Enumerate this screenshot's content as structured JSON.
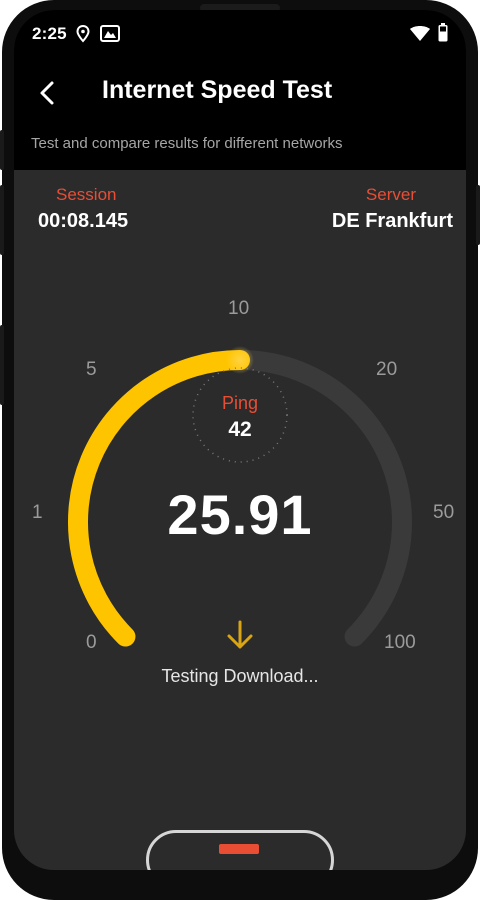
{
  "status_bar": {
    "time": "2:25"
  },
  "header": {
    "title": "Internet Speed Test",
    "subtitle": "Test and compare results for different networks"
  },
  "session": {
    "label": "Session",
    "value": "00:08.145"
  },
  "server": {
    "label": "Server",
    "value": "DE Frankfurt"
  },
  "gauge": {
    "scale": [
      "0",
      "1",
      "5",
      "10",
      "20",
      "50",
      "100"
    ],
    "progress_fraction": 0.5,
    "ping_label": "Ping",
    "ping_value": "42",
    "speed": "25.91",
    "status": "Testing Download..."
  },
  "colors": {
    "accent": "#ffc400",
    "label_red": "#e94e35",
    "track": "#3a3a3b",
    "background": "#2b2b2c"
  },
  "icons": [
    "location-icon",
    "gallery-icon",
    "wifi-icon",
    "battery-icon",
    "back-arrow-icon",
    "download-arrow-icon"
  ]
}
